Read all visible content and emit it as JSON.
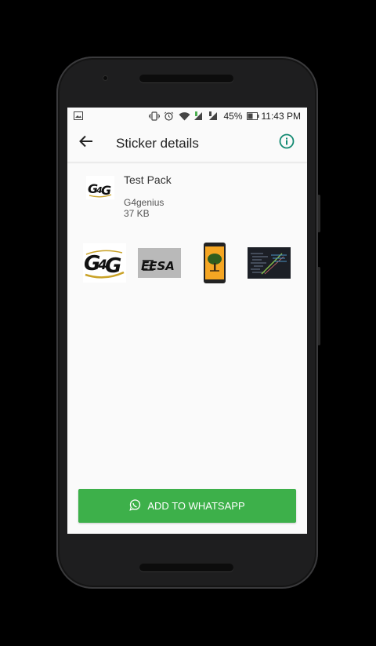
{
  "status_bar": {
    "battery_percent": "45%",
    "time": "11:43 PM"
  },
  "app_bar": {
    "title": "Sticker details"
  },
  "pack": {
    "name": "Test Pack",
    "publisher": "G4genius",
    "size": "37 KB"
  },
  "stickers": [
    {
      "icon": "g4g-logo"
    },
    {
      "icon": "eesa-logo"
    },
    {
      "icon": "phone-tree-image"
    },
    {
      "icon": "code-screenshot"
    }
  ],
  "action": {
    "label": "ADD TO WHATSAPP"
  },
  "colors": {
    "accent_green": "#3db04a",
    "info_teal": "#138a72"
  }
}
